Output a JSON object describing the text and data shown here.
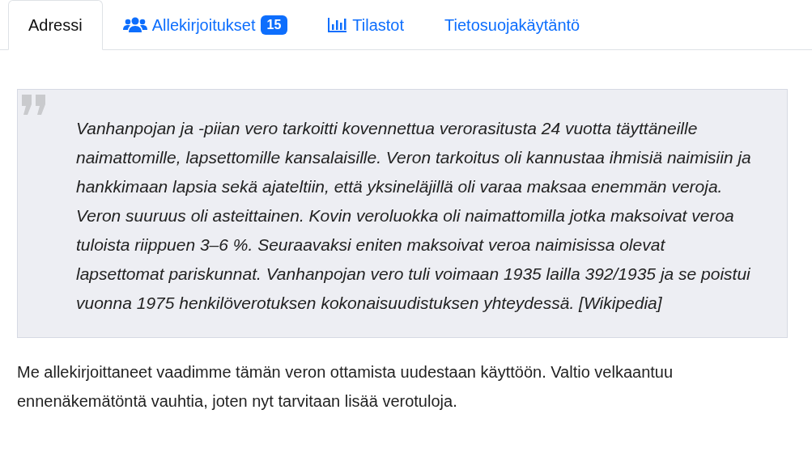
{
  "tabs": [
    {
      "label": "Adressi",
      "kind": "plain",
      "selected": true
    },
    {
      "label": "Allekirjoitukset",
      "kind": "people",
      "badge": "15",
      "selected": false
    },
    {
      "label": "Tilastot",
      "kind": "stats",
      "selected": false
    },
    {
      "label": "Tietosuojakäytäntö",
      "kind": "plain",
      "selected": false
    }
  ],
  "quote": {
    "text": "Vanhanpojan ja -piian vero tarkoitti kovennettua verorasitusta 24 vuotta täyttäneille naimattomille, lapsettomille kansalaisille. Veron tarkoitus oli kannustaa ihmisiä naimisiin ja hankkimaan lapsia sekä ajateltiin, että yksineläjillä oli varaa maksaa enemmän veroja. Veron suuruus oli asteittainen. Kovin veroluokka oli naimattomilla jotka maksoivat veroa tuloista riippuen 3–6 %. Seuraavaksi eniten maksoivat veroa naimisissa olevat lapsettomat pariskunnat. Vanhanpojan vero tuli voimaan 1935 lailla 392/1935 ja se poistui vuonna 1975 henkilöverotuksen kokonaisuudistuksen yhteydessä. [Wikipedia]"
  },
  "paragraph": "Me allekirjoittaneet vaadimme tämän veron ottamista uudestaan käyttöön. Valtio velkaantuu ennenäkemätöntä vauhtia, joten nyt tarvitaan lisää verotuloja."
}
